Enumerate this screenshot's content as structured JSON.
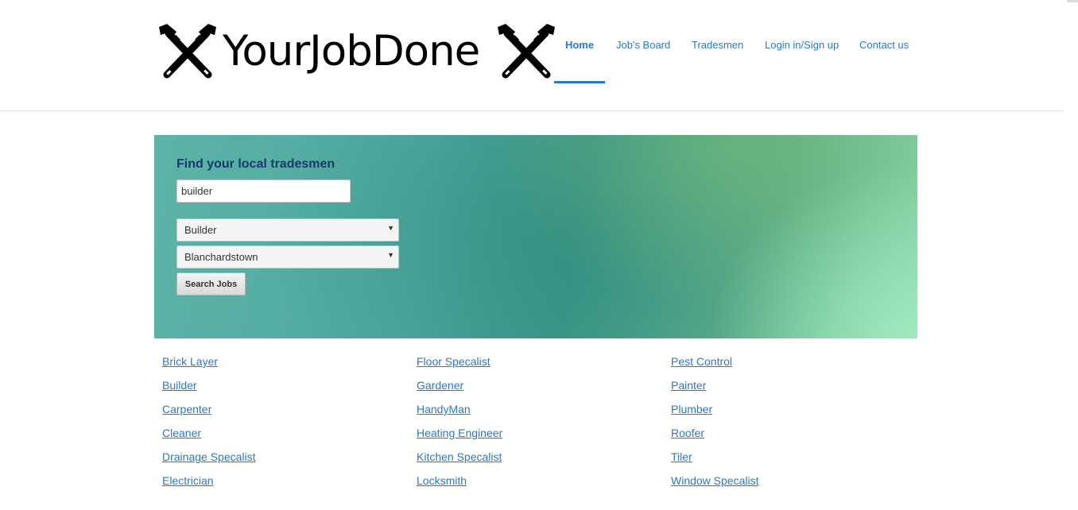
{
  "logo": {
    "text": "YourJobDone",
    "icon": "crossed-wrenches-icon"
  },
  "nav": {
    "items": [
      {
        "label": "Home",
        "active": true
      },
      {
        "label": "Job's Board",
        "active": false
      },
      {
        "label": "Tradesmen",
        "active": false
      },
      {
        "label": "Login in/Sign up",
        "active": false
      },
      {
        "label": "Contact us",
        "active": false
      }
    ]
  },
  "hero": {
    "title": "Find your local tradesmen",
    "search_value": "builder",
    "trade_select": {
      "selected": "Builder"
    },
    "area_select": {
      "selected": "Blanchardstown"
    },
    "search_button": "Search Jobs"
  },
  "trades": {
    "columns": [
      [
        "Brick Layer",
        "Builder",
        "Carpenter",
        "Cleaner",
        "Drainage Specalist",
        "Electrician"
      ],
      [
        "Floor Specalist",
        "Gardener",
        "HandyMan",
        "Heating Engineer",
        "Kitchen Specalist",
        "Locksmith"
      ],
      [
        "Pest Control",
        "Painter",
        "Plumber",
        "Roofer",
        "Tiler",
        "Window Specalist"
      ]
    ]
  },
  "colors": {
    "link": "#2a78c2",
    "hero_title": "#173a6b",
    "hero_teal": "#4ea89e",
    "hero_green": "#86d3a8"
  }
}
